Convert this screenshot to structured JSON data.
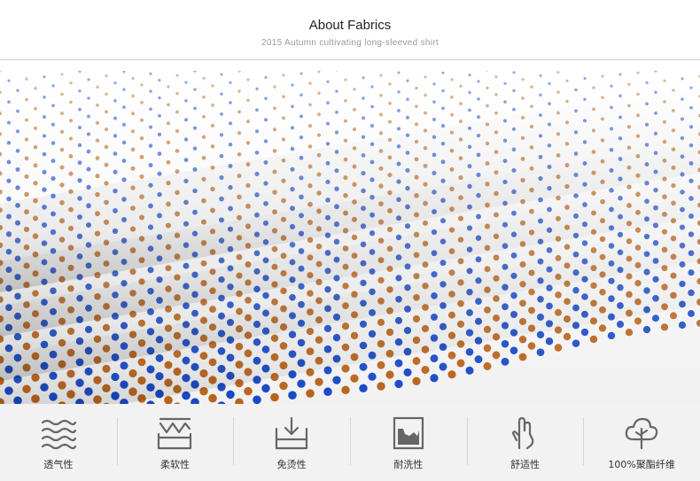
{
  "header": {
    "title": "About Fabrics",
    "subtitle": "2015 Autumn cultivating long-sleeved shirt"
  },
  "colors": {
    "dot_orange": "#b8641e",
    "dot_blue": "#1a49c4",
    "fabric_white": "#ffffff",
    "icon_gray": "#666666",
    "bar_bg": "#f2f2f2"
  },
  "features": [
    {
      "icon": "wave-icon",
      "label": "透气性"
    },
    {
      "icon": "bounce-icon",
      "label": "柔软性"
    },
    {
      "icon": "no-iron-icon",
      "label": "免烫性"
    },
    {
      "icon": "wash-icon",
      "label": "耐洗性"
    },
    {
      "icon": "hand-icon",
      "label": "舒适性"
    },
    {
      "icon": "tree-icon",
      "label": "100%聚酯纤维"
    }
  ]
}
